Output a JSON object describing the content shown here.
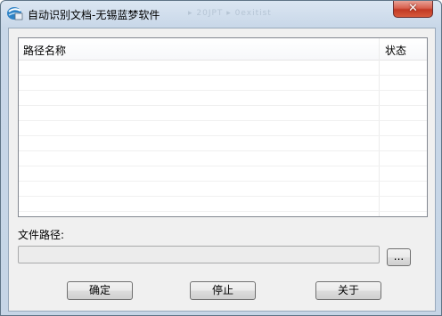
{
  "window": {
    "title": "自动识别文档-无锡蓝梦软件",
    "ghost_text": "▸ 20JPT ▸ 0exitist",
    "close_label": "✕"
  },
  "list": {
    "columns": [
      "路径名称",
      "状态"
    ],
    "rows": []
  },
  "path": {
    "label": "文件路径:",
    "value": "",
    "browse_label": "..."
  },
  "buttons": {
    "ok_label": "确定",
    "stop_label": "停止",
    "about_label": "关于"
  },
  "colors": {
    "titlebar": "#c8d7e8",
    "close_button": "#c23a24",
    "client_bg": "#f0f0f0"
  }
}
